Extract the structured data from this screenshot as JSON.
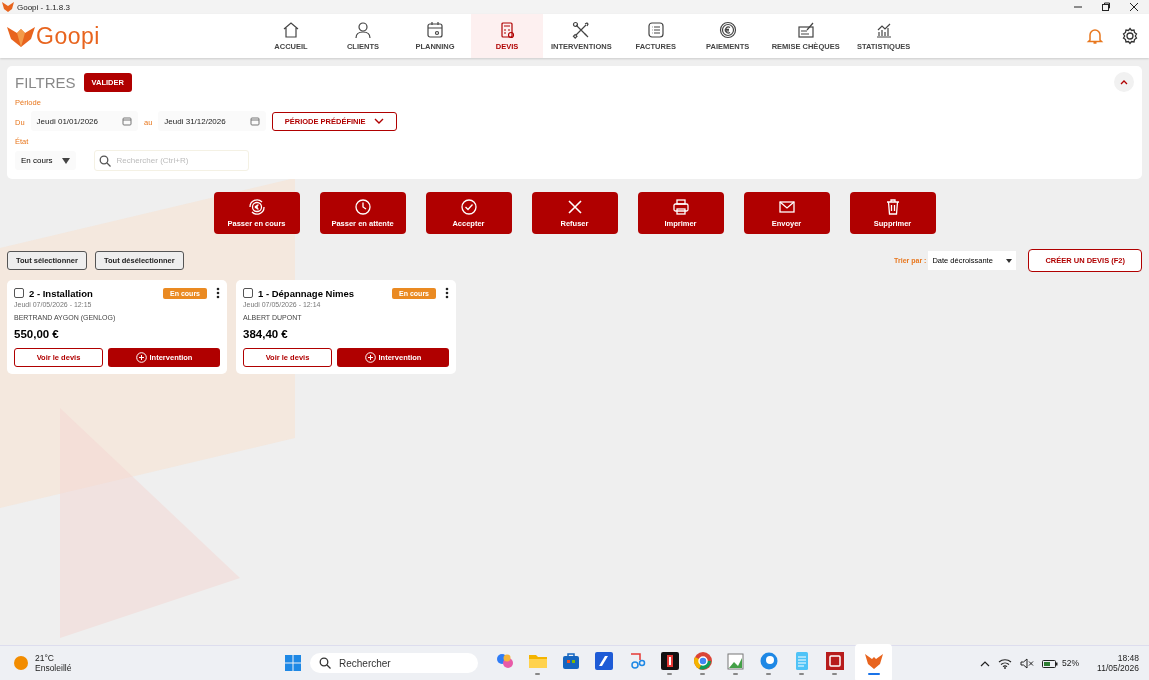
{
  "window": {
    "title": "Goopi - 1.1.8.3"
  },
  "app": {
    "logo": "Goopi"
  },
  "nav": [
    {
      "label": "ACCUEIL",
      "selected": false
    },
    {
      "label": "CLIENTS",
      "selected": false
    },
    {
      "label": "PLANNING",
      "selected": false
    },
    {
      "label": "DEVIS",
      "selected": true
    },
    {
      "label": "INTERVENTIONS",
      "selected": false
    },
    {
      "label": "FACTURES",
      "selected": false
    },
    {
      "label": "PAIEMENTS",
      "selected": false
    },
    {
      "label": "REMISE CHÈQUES",
      "selected": false
    },
    {
      "label": "STATISTIQUES",
      "selected": false
    }
  ],
  "filters": {
    "title": "FILTRES",
    "validate": "VALIDER",
    "period_label": "Période",
    "from_label": "Du",
    "from": "Jeudi 01/01/2026",
    "to_label": "au",
    "to": "Jeudi 31/12/2026",
    "preset": "PÉRIODE PRÉDÉFINIE",
    "state_label": "État",
    "state": "En cours",
    "search_placeholder": "Rechercher (Ctrl+R)"
  },
  "actions": [
    {
      "label": "Passer en cours"
    },
    {
      "label": "Passer en attente"
    },
    {
      "label": "Accepter"
    },
    {
      "label": "Refuser"
    },
    {
      "label": "Imprimer"
    },
    {
      "label": "Envoyer"
    },
    {
      "label": "Supprimer"
    }
  ],
  "toolbar": {
    "select_all": "Tout sélectionner",
    "deselect_all": "Tout désélectionner",
    "sort_label": "Trier par :",
    "sort_value": "Date décroissante",
    "create": "CRÉER UN DEVIS (F2)"
  },
  "quotes": [
    {
      "title": "2 - Installation",
      "checked": false,
      "date": "Jeudi 07/05/2026 - 12:15",
      "status": "En cours",
      "client": "BERTRAND AYGON (GENLOG)",
      "amount": "550,00 €",
      "view": "Voir le devis",
      "intervention": "Intervention"
    },
    {
      "title": "1 - Dépannage Nimes",
      "checked": false,
      "date": "Jeudi 07/05/2026 - 12:14",
      "status": "En cours",
      "client": "ALBERT DUPONT",
      "amount": "384,40 €",
      "view": "Voir le devis",
      "intervention": "Intervention"
    }
  ],
  "taskbar": {
    "weather_temp": "21°C",
    "weather_desc": "Ensoleillé",
    "search": "Rechercher",
    "apps": [
      {
        "running": false,
        "selected": false
      },
      {
        "running": true,
        "selected": false
      },
      {
        "running": false,
        "selected": false
      },
      {
        "running": false,
        "selected": false
      },
      {
        "running": false,
        "selected": false
      },
      {
        "running": true,
        "selected": false
      },
      {
        "running": true,
        "selected": false
      },
      {
        "running": true,
        "selected": false
      },
      {
        "running": true,
        "selected": false
      },
      {
        "running": true,
        "selected": false
      },
      {
        "running": true,
        "selected": false
      },
      {
        "running": true,
        "selected": true
      }
    ],
    "battery": "52%",
    "time": "18:48",
    "date": "11/05/2026"
  }
}
